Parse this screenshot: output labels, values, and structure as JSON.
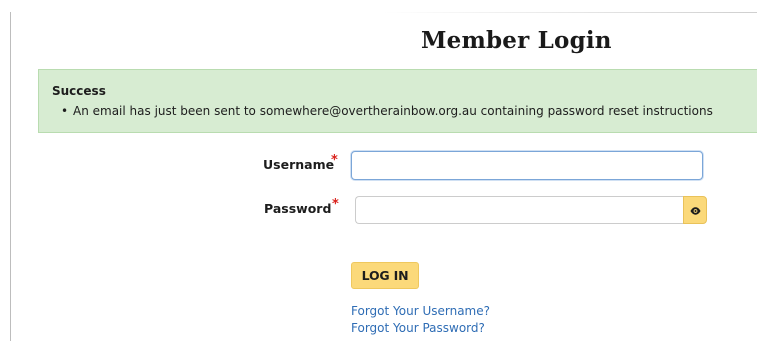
{
  "page": {
    "title": "Member Login"
  },
  "alert": {
    "title": "Success",
    "bullet": "•",
    "messages": [
      "An email has just been sent to somewhere@overtherainbow.org.au containing password reset instructions"
    ],
    "colors": {
      "background": "#d7ecd2",
      "border": "#b9dcb0"
    }
  },
  "form": {
    "username": {
      "label": "Username",
      "required_marker": "*",
      "value": "",
      "placeholder": ""
    },
    "password": {
      "label": "Password",
      "required_marker": "*",
      "value": "",
      "placeholder": "",
      "reveal_icon": "eye-icon"
    },
    "submit_label": "LOG IN"
  },
  "links": {
    "forgot_username": "Forgot Your Username?",
    "forgot_password": "Forgot Your Password?"
  },
  "colors": {
    "accent_button": "#fbd97a",
    "link": "#2f6db5",
    "required": "#d9211b",
    "focus_border": "#7ba6d8"
  }
}
